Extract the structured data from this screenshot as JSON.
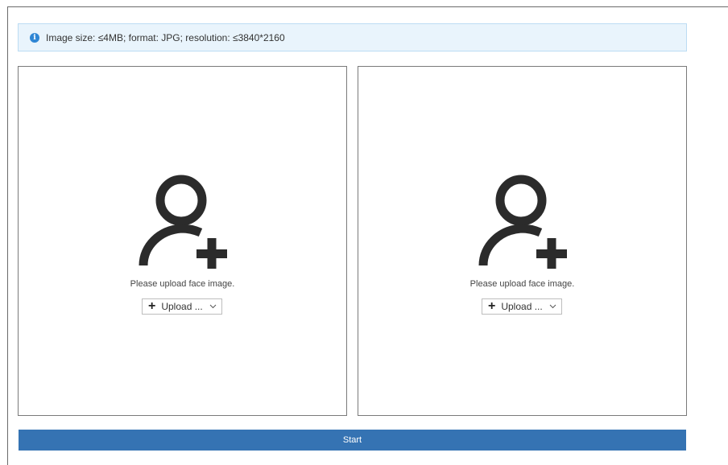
{
  "info": {
    "icon": "info-icon",
    "text": "Image size: ≤4MB; format: JPG; resolution: ≤3840*2160"
  },
  "panels": [
    {
      "icon": "add-user-icon",
      "prompt": "Please upload face image.",
      "upload_label": "Upload ...",
      "upload_icon": "plus-icon",
      "dropdown_icon": "chevron-down-icon"
    },
    {
      "icon": "add-user-icon",
      "prompt": "Please upload face image.",
      "upload_label": "Upload ...",
      "upload_icon": "plus-icon",
      "dropdown_icon": "chevron-down-icon"
    }
  ],
  "actions": {
    "start_label": "Start"
  },
  "colors": {
    "info_background": "#e9f4fc",
    "info_icon": "#2f86d4",
    "start_button": "#3573b3",
    "avatar": "#2b2b2b"
  }
}
